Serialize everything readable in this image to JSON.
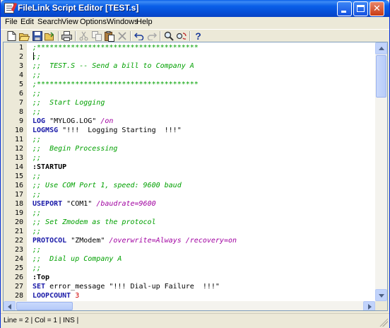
{
  "window": {
    "title": "FileLink Script Editor [TEST.s]",
    "colors": {
      "titlebar": "#0a5fe8",
      "close": "#c83a14"
    }
  },
  "menu": [
    "File",
    "Edit",
    "Search",
    "View",
    "Options",
    "Windows",
    "Help"
  ],
  "toolbar": {
    "icons": [
      "new-file-icon",
      "open-folder-icon",
      "save-icon",
      "open-icon",
      "print-icon",
      "cut-icon",
      "copy-icon",
      "paste-icon",
      "delete-icon",
      "undo-icon",
      "redo-icon",
      "find-icon",
      "replace-icon",
      "help-icon"
    ]
  },
  "editor": {
    "colors": {
      "comment": "#00a000",
      "keyword": "#1a1aa8",
      "option": "#a000a0",
      "number": "#d00000"
    },
    "lines": [
      {
        "n": "1",
        "parts": [
          [
            "comment",
            ";**************************************"
          ]
        ]
      },
      {
        "n": "2",
        "parts": [
          [
            "comment",
            ";;"
          ]
        ]
      },
      {
        "n": "3",
        "parts": [
          [
            "comment",
            ";;  TEST.S -- Send a bill to Company A"
          ]
        ]
      },
      {
        "n": "4",
        "parts": [
          [
            "comment",
            ";;"
          ]
        ]
      },
      {
        "n": "5",
        "parts": [
          [
            "comment",
            ";**************************************"
          ]
        ]
      },
      {
        "n": "6",
        "parts": [
          [
            "comment",
            ";;"
          ]
        ]
      },
      {
        "n": "7",
        "parts": [
          [
            "comment",
            ";;  Start Logging"
          ]
        ]
      },
      {
        "n": "8",
        "parts": [
          [
            "comment",
            ";;"
          ]
        ]
      },
      {
        "n": "9",
        "parts": [
          [
            "keyword",
            "LOG"
          ],
          [
            "string",
            " \"MYLOG.LOG\" "
          ],
          [
            "option",
            "/on"
          ]
        ]
      },
      {
        "n": "10",
        "parts": [
          [
            "keyword",
            "LOGMSG"
          ],
          [
            "string",
            " \"!!!  Logging Starting  !!!\""
          ]
        ]
      },
      {
        "n": "11",
        "parts": [
          [
            "comment",
            ";;"
          ]
        ]
      },
      {
        "n": "12",
        "parts": [
          [
            "comment",
            ";;  Begin Processing"
          ]
        ]
      },
      {
        "n": "13",
        "parts": [
          [
            "comment",
            ";;"
          ]
        ]
      },
      {
        "n": "14",
        "parts": [
          [
            "label",
            ":STARTUP"
          ]
        ]
      },
      {
        "n": "15",
        "parts": [
          [
            "comment",
            ";;"
          ]
        ]
      },
      {
        "n": "16",
        "parts": [
          [
            "comment",
            ";; Use COM Port 1, speed: 9600 baud"
          ]
        ]
      },
      {
        "n": "17",
        "parts": [
          [
            "comment",
            ";;"
          ]
        ]
      },
      {
        "n": "18",
        "parts": [
          [
            "keyword",
            "USEPORT"
          ],
          [
            "string",
            " \"COM1\" "
          ],
          [
            "option",
            "/baudrate=9600"
          ]
        ]
      },
      {
        "n": "19",
        "parts": [
          [
            "comment",
            ";;"
          ]
        ]
      },
      {
        "n": "20",
        "parts": [
          [
            "comment",
            ";; Set Zmodem as the protocol"
          ]
        ]
      },
      {
        "n": "21",
        "parts": [
          [
            "comment",
            ";;"
          ]
        ]
      },
      {
        "n": "22",
        "parts": [
          [
            "keyword",
            "PROTOCOL"
          ],
          [
            "string",
            " \"ZModem\" "
          ],
          [
            "option",
            "/overwrite=Always /recovery=on"
          ]
        ]
      },
      {
        "n": "23",
        "parts": [
          [
            "comment",
            ";;"
          ]
        ]
      },
      {
        "n": "24",
        "parts": [
          [
            "comment",
            ";;  Dial up Company A"
          ]
        ]
      },
      {
        "n": "25",
        "parts": [
          [
            "comment",
            ";;"
          ]
        ]
      },
      {
        "n": "26",
        "parts": [
          [
            "label",
            ":Top"
          ]
        ]
      },
      {
        "n": "27",
        "parts": [
          [
            "keyword",
            "SET"
          ],
          [
            "string",
            " error_message \"!!! Dial-up Failure  !!!\""
          ]
        ]
      },
      {
        "n": "28",
        "parts": [
          [
            "keyword",
            "LOOPCOUNT"
          ],
          [
            "number",
            " 3"
          ]
        ]
      }
    ]
  },
  "status": {
    "text": "Line = 2 | Col = 1 | INS |"
  }
}
